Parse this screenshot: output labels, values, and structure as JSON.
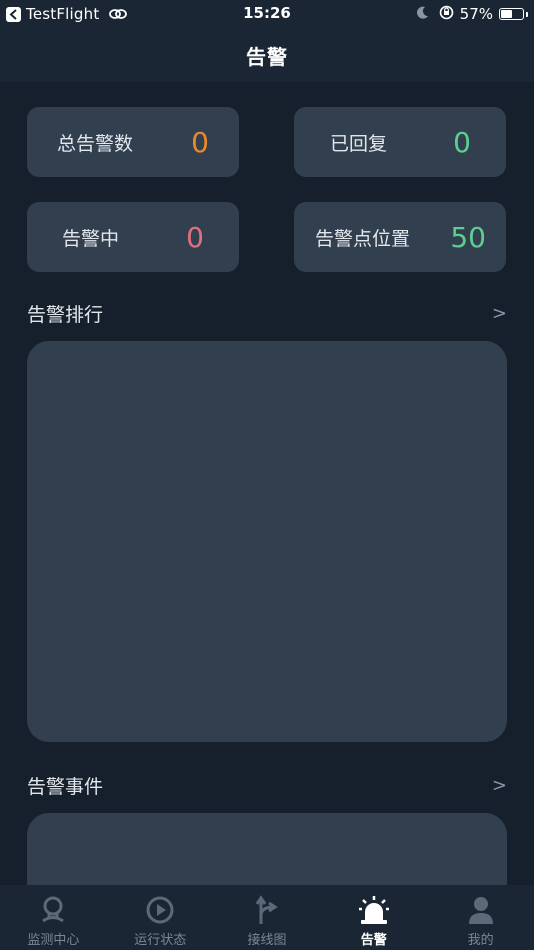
{
  "status_bar": {
    "app_name": "TestFlight",
    "time": "15:26",
    "battery": "57%",
    "battery_level": 0.57
  },
  "nav": {
    "title": "告警"
  },
  "stats": [
    {
      "label": "总告警数",
      "value": "0",
      "color": "#e8892a"
    },
    {
      "label": "已回复",
      "value": "0",
      "color": "#5ccf8e"
    },
    {
      "label": "告警中",
      "value": "0",
      "color": "#e0707f"
    },
    {
      "label": "告警点位置",
      "value": "50",
      "color": "#5ccf8e"
    }
  ],
  "sections": {
    "ranking": {
      "title": "告警排行",
      "more": ">"
    },
    "events": {
      "title": "告警事件",
      "more": ">"
    }
  },
  "tabs": [
    {
      "label": "监测中心",
      "icon": "monitor-center-icon"
    },
    {
      "label": "运行状态",
      "icon": "play-circle-icon"
    },
    {
      "label": "接线图",
      "icon": "fork-arrow-icon"
    },
    {
      "label": "告警",
      "icon": "alarm-light-icon",
      "active": true
    },
    {
      "label": "我的",
      "icon": "user-icon"
    }
  ],
  "colors": {
    "background": "#16202c",
    "card": "#323f4f",
    "bar": "#1a2633",
    "tab_inactive": "#7b8796"
  }
}
